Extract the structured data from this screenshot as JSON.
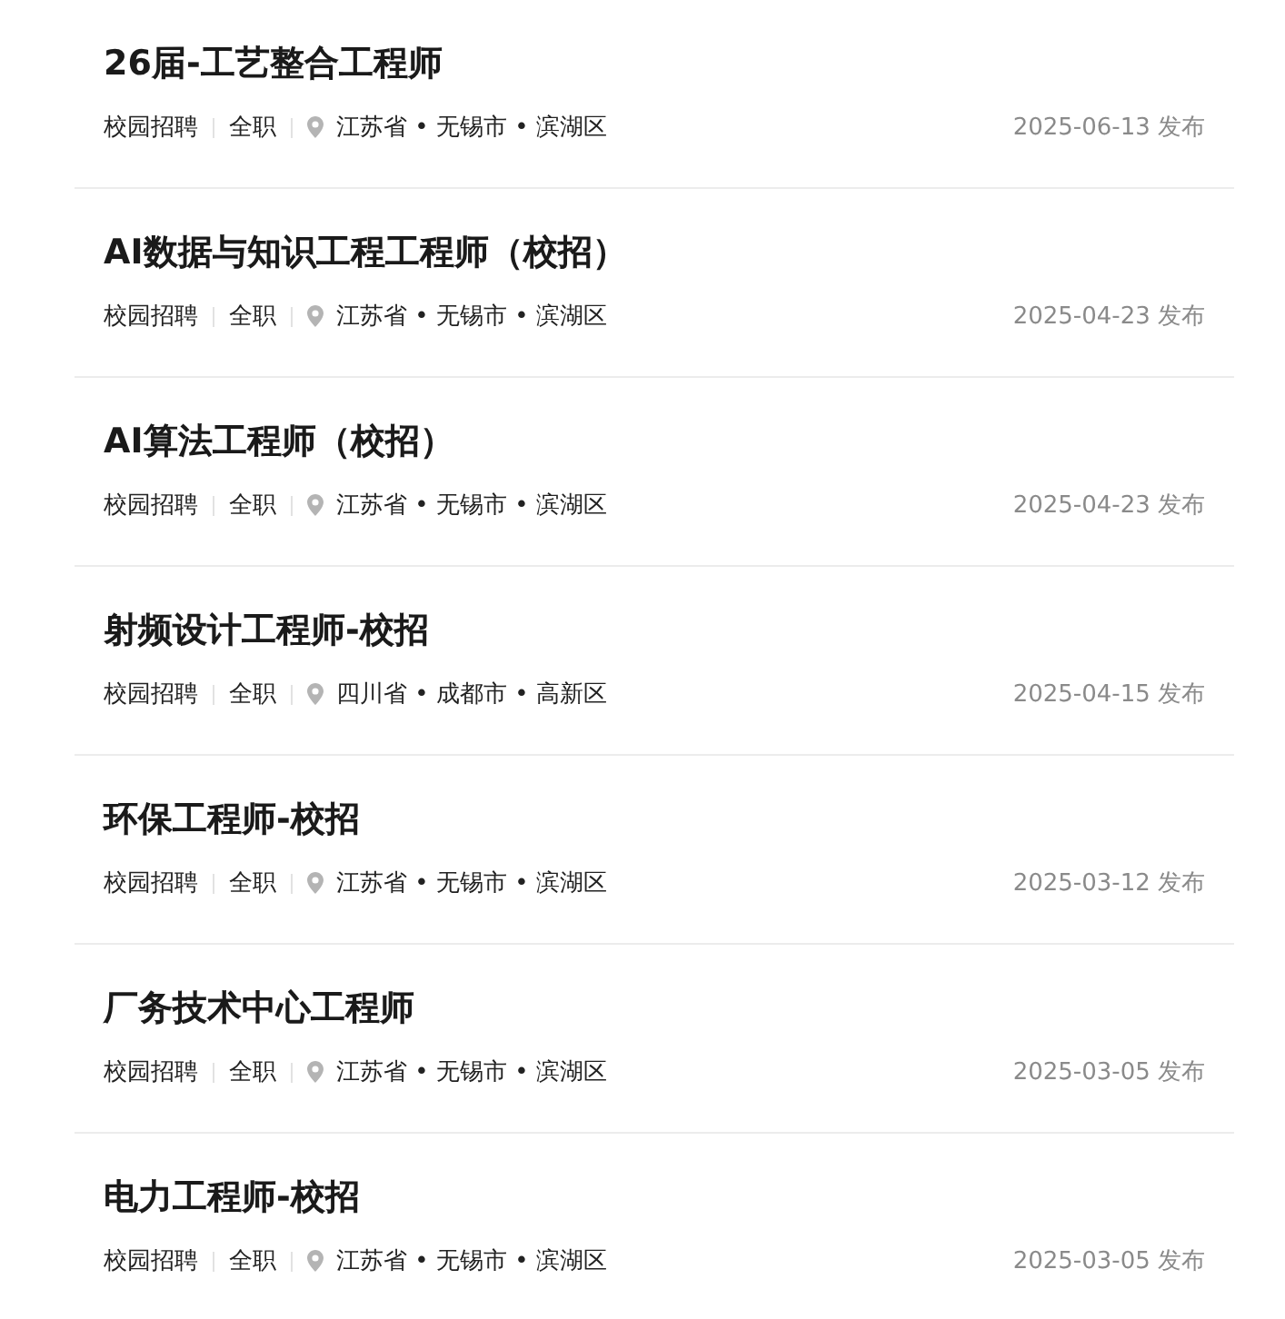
{
  "jobs": [
    {
      "title": "26届-工艺整合工程师",
      "type": "校园招聘",
      "employment": "全职",
      "location": "江苏省 • 无锡市 • 滨湖区",
      "date": "2025-06-13 发布"
    },
    {
      "title": "AI数据与知识工程工程师（校招）",
      "type": "校园招聘",
      "employment": "全职",
      "location": "江苏省 • 无锡市 • 滨湖区",
      "date": "2025-04-23 发布"
    },
    {
      "title": "AI算法工程师（校招）",
      "type": "校园招聘",
      "employment": "全职",
      "location": "江苏省 • 无锡市 • 滨湖区",
      "date": "2025-04-23 发布"
    },
    {
      "title": "射频设计工程师-校招",
      "type": "校园招聘",
      "employment": "全职",
      "location": "四川省 • 成都市 • 高新区",
      "date": "2025-04-15 发布"
    },
    {
      "title": "环保工程师-校招",
      "type": "校园招聘",
      "employment": "全职",
      "location": "江苏省 • 无锡市 • 滨湖区",
      "date": "2025-03-12 发布"
    },
    {
      "title": "厂务技术中心工程师",
      "type": "校园招聘",
      "employment": "全职",
      "location": "江苏省 • 无锡市 • 滨湖区",
      "date": "2025-03-05 发布"
    },
    {
      "title": "电力工程师-校招",
      "type": "校园招聘",
      "employment": "全职",
      "location": "江苏省 • 无锡市 • 滨湖区",
      "date": "2025-03-05 发布"
    }
  ]
}
